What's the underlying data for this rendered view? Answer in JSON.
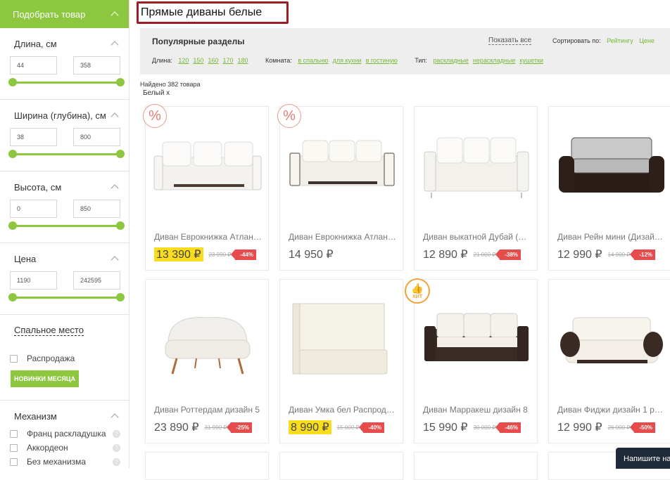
{
  "sidebar": {
    "header": "Подобрать товар",
    "length": {
      "title": "Длина, см",
      "min": "44",
      "max": "358"
    },
    "width": {
      "title": "Ширина (глубина), см",
      "min": "38",
      "max": "800"
    },
    "height": {
      "title": "Высота, см",
      "min": "0",
      "max": "850"
    },
    "price": {
      "title": "Цена",
      "min": "1190",
      "max": "242595"
    },
    "sleep": "Спальное место",
    "sale": "Распродажа",
    "new_btn": "НОВИНКИ МЕСЯЦА",
    "mechanism": {
      "title": "Механизм",
      "items": [
        {
          "label": "Франц раскладушка"
        },
        {
          "label": "Аккордеон"
        },
        {
          "label": "Без механизма"
        }
      ]
    }
  },
  "page": {
    "title": "Прямые диваны белые",
    "found": "Найдено 382 товара",
    "chip": "Белый x"
  },
  "popular": {
    "title": "Популярные разделы",
    "show_all": "Показать все",
    "sort_label": "Сортировать по:",
    "sort_rating": "Рейтингу",
    "sort_price": "Цене",
    "length_label": "Длина:",
    "lengths": [
      "120",
      "150",
      "160",
      "170",
      "180"
    ],
    "room_label": "Комната:",
    "rooms": [
      "в спальню",
      "для кухни",
      "в гостиную"
    ],
    "type_label": "Тип:",
    "types": [
      "раскладные",
      "нераскладные",
      "кушетки"
    ]
  },
  "products": [
    {
      "name": "Диван Еврокнижка Атлан…",
      "price": "13 390 ₽",
      "old": "23 990 ₽",
      "disc": "-44%",
      "hl": true,
      "badge": "%"
    },
    {
      "name": "Диван Еврокнижка Атлан…",
      "price": "14 950 ₽",
      "old": "",
      "disc": "",
      "hl": false,
      "badge": "%"
    },
    {
      "name": "Диван выкатной Дубай (…",
      "price": "12 890 ₽",
      "old": "21 000 ₽",
      "disc": "-38%",
      "hl": false,
      "badge": ""
    },
    {
      "name": "Диван Рейн мини (Дизай…",
      "price": "12 990 ₽",
      "old": "14 900 ₽",
      "disc": "-12%",
      "hl": false,
      "badge": ""
    },
    {
      "name": "Диван Роттердам дизайн 5",
      "price": "23 890 ₽",
      "old": "31 990 ₽",
      "disc": "-25%",
      "hl": false,
      "badge": ""
    },
    {
      "name": "Диван Умка бел Распрод…",
      "price": "8 990 ₽",
      "old": "15 000 ₽",
      "disc": "-40%",
      "hl": true,
      "badge": ""
    },
    {
      "name": "Диван Марракеш дизайн 8",
      "price": "15 990 ₽",
      "old": "30 000 ₽",
      "disc": "-46%",
      "hl": false,
      "badge": "hit"
    },
    {
      "name": "Диван Фиджи дизайн 1 р…",
      "price": "12 990 ₽",
      "old": "26 000 ₽",
      "disc": "-50%",
      "hl": false,
      "badge": ""
    }
  ],
  "hit_label": "ХИТ",
  "chat": "Напишите на"
}
